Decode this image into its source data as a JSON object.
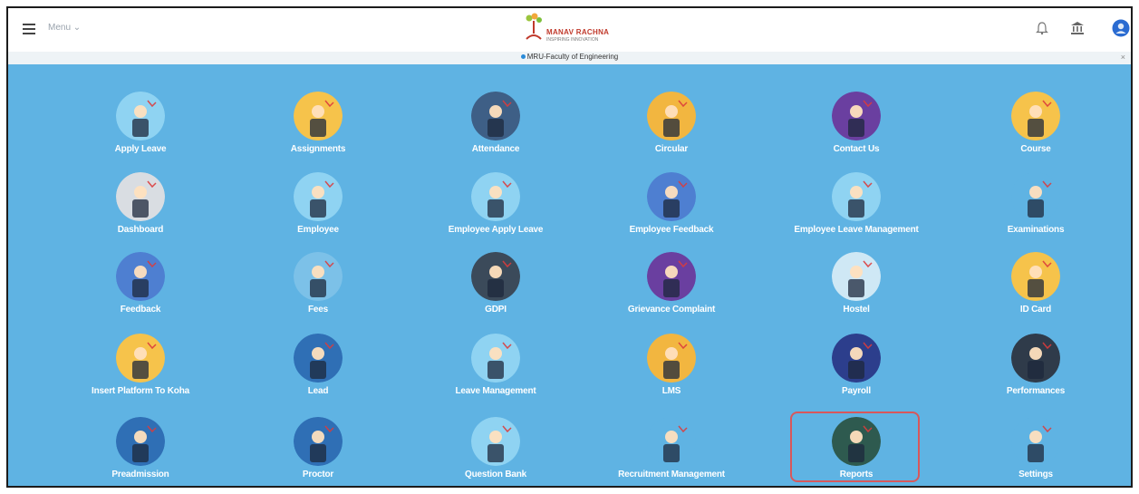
{
  "topbar": {
    "menu_label": "Menu ⌄",
    "logo_name": "MANAV RACHNA",
    "logo_tagline": "INSPIRING INNOVATION",
    "icons": [
      "menu-icon",
      "bell-icon",
      "institution-icon",
      "user-avatar-icon"
    ]
  },
  "banner": {
    "text": "MRU-Faculty of Engineering",
    "close": "×"
  },
  "colors": {
    "background": "#5fb3e3",
    "tile_label": "#ffffff",
    "highlight_border": "#d8575b",
    "brand_red": "#c0392b"
  },
  "tiles": [
    {
      "label": "Apply Leave",
      "icon": "apply-leave-icon",
      "color": "#8fd3f2"
    },
    {
      "label": "Assignments",
      "icon": "assignments-icon",
      "color": "#f6c34b"
    },
    {
      "label": "Attendance",
      "icon": "attendance-icon",
      "color": "#3e5f86"
    },
    {
      "label": "Circular",
      "icon": "circular-icon",
      "color": "#f2b640"
    },
    {
      "label": "Contact Us",
      "icon": "contact-us-icon",
      "color": "#6a3fa0"
    },
    {
      "label": "Course",
      "icon": "course-icon",
      "color": "#f6c34b"
    },
    {
      "label": "Dashboard",
      "icon": "dashboard-icon",
      "color": "#d9dde2"
    },
    {
      "label": "Employee",
      "icon": "employee-icon",
      "color": "#8fd3f2"
    },
    {
      "label": "Employee Apply Leave",
      "icon": "employee-apply-leave-icon",
      "color": "#8fd3f2"
    },
    {
      "label": "Employee Feedback",
      "icon": "employee-feedback-icon",
      "color": "#4e7fd1"
    },
    {
      "label": "Employee Leave Management",
      "icon": "employee-leave-management-icon",
      "color": "#8fd3f2"
    },
    {
      "label": "Examinations",
      "icon": "examinations-icon",
      "color": "#5fb3e3"
    },
    {
      "label": "Feedback",
      "icon": "feedback-icon",
      "color": "#4e7fd1"
    },
    {
      "label": "Fees",
      "icon": "fees-icon",
      "color": "#7cc1e8"
    },
    {
      "label": "GDPI",
      "icon": "gdpi-icon",
      "color": "#3b4a5a"
    },
    {
      "label": "Grievance Complaint",
      "icon": "grievance-complaint-icon",
      "color": "#6a3fa0"
    },
    {
      "label": "Hostel",
      "icon": "hostel-icon",
      "color": "#cfe8f5"
    },
    {
      "label": "ID Card",
      "icon": "id-card-icon",
      "color": "#f6c34b"
    },
    {
      "label": "Insert Platform To Koha",
      "icon": "insert-platform-to-koha-icon",
      "color": "#f6c34b"
    },
    {
      "label": "Lead",
      "icon": "lead-icon",
      "color": "#2f6fb5"
    },
    {
      "label": "Leave Management",
      "icon": "leave-management-icon",
      "color": "#8fd3f2"
    },
    {
      "label": "LMS",
      "icon": "lms-icon",
      "color": "#f2b640"
    },
    {
      "label": "Payroll",
      "icon": "payroll-icon",
      "color": "#2c3e8c"
    },
    {
      "label": "Performances",
      "icon": "performances-icon",
      "color": "#2f3b4a"
    },
    {
      "label": "Preadmission",
      "icon": "preadmission-icon",
      "color": "#2f6fb5"
    },
    {
      "label": "Proctor",
      "icon": "proctor-icon",
      "color": "#2f6fb5"
    },
    {
      "label": "Question Bank",
      "icon": "question-bank-icon",
      "color": "#8fd3f2"
    },
    {
      "label": "Recruitment Management",
      "icon": "recruitment-management-icon",
      "color": "#5fb3e3"
    },
    {
      "label": "Reports",
      "icon": "reports-icon",
      "color": "#2e5a4f"
    },
    {
      "label": "Settings",
      "icon": "settings-icon",
      "color": "#5fb3e3"
    }
  ]
}
